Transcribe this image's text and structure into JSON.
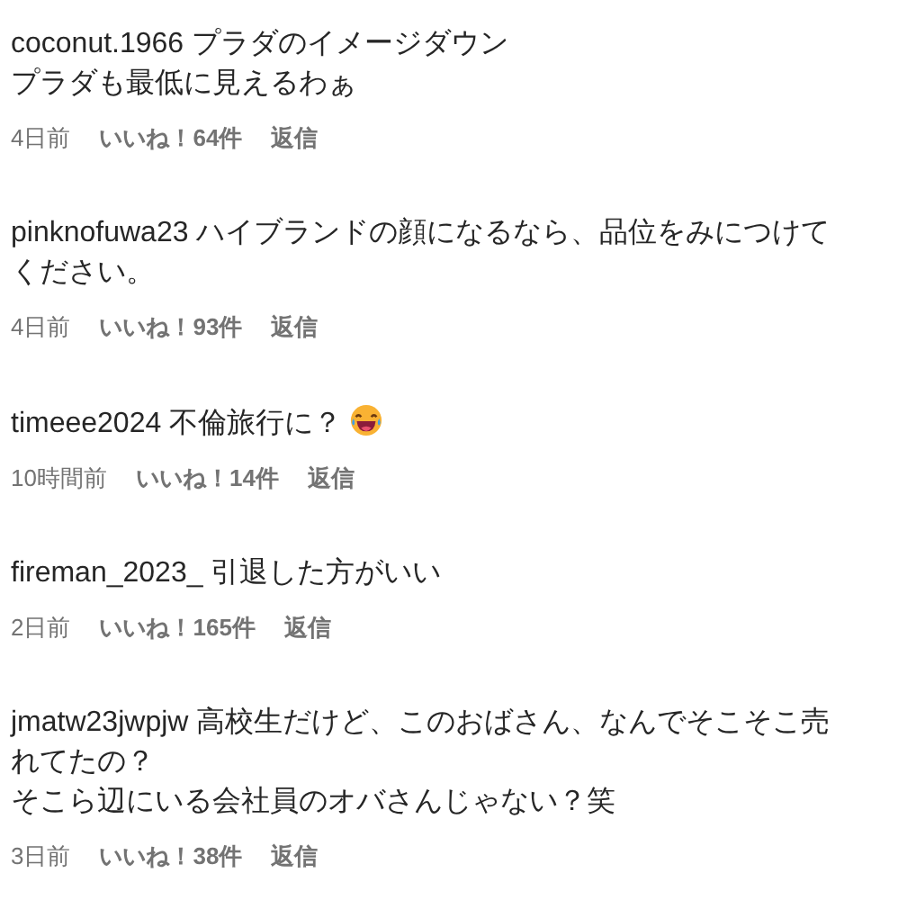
{
  "comments": [
    {
      "username": "coconut.1966",
      "lines": [
        "プラダのイメージダウン",
        "プラダも最低に見えるわぁ"
      ],
      "laughing_emoji": false,
      "time": "4日前",
      "likes": "いいね！64件",
      "reply": "返信"
    },
    {
      "username": "pinknofuwa23",
      "lines": [
        "ハイブランドの顔になるなら、品位をみにつけてください。"
      ],
      "laughing_emoji": false,
      "time": "4日前",
      "likes": "いいね！93件",
      "reply": "返信"
    },
    {
      "username": "timeee2024",
      "lines": [
        "不倫旅行に？"
      ],
      "laughing_emoji": true,
      "time": "10時間前",
      "likes": "いいね！14件",
      "reply": "返信"
    },
    {
      "username": "fireman_2023_",
      "lines": [
        "引退した方がいい"
      ],
      "laughing_emoji": false,
      "time": "2日前",
      "likes": "いいね！165件",
      "reply": "返信"
    },
    {
      "username": "jmatw23jwpjw",
      "lines": [
        "高校生だけど、このおばさん、なんでそこそこ売れてたの？",
        "そこら辺にいる会社員のオバさんじゃない？笑"
      ],
      "laughing_emoji": false,
      "time": "3日前",
      "likes": "いいね！38件",
      "reply": "返信"
    }
  ]
}
